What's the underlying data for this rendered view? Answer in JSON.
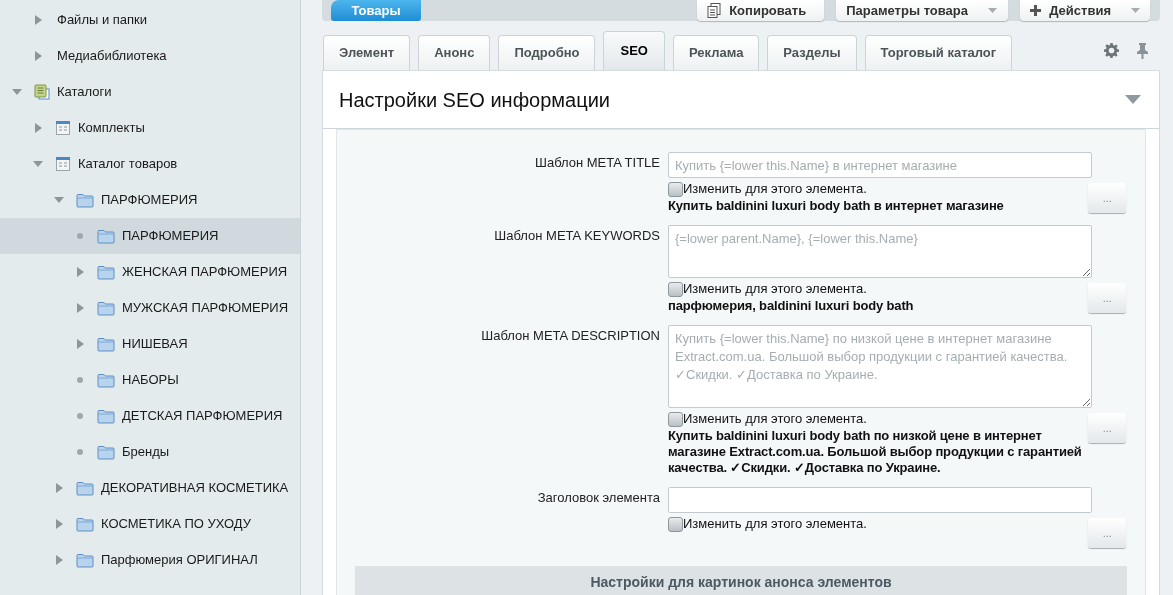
{
  "sidebar": {
    "items": [
      {
        "label": "Файлы и папки",
        "kind": "plain",
        "expanded": false,
        "selected": false
      },
      {
        "label": "Медиабиблиотека",
        "kind": "plain",
        "expanded": false,
        "selected": false
      },
      {
        "label": "Каталоги",
        "kind": "catalog",
        "expanded": true,
        "selected": false,
        "children": [
          {
            "label": "Комплекты",
            "kind": "list",
            "expanded": false,
            "selected": false
          },
          {
            "label": "Каталог товаров",
            "kind": "list",
            "expanded": true,
            "selected": false,
            "children": [
              {
                "label": "ПАРФЮМЕРИЯ",
                "kind": "folder",
                "expanded": true,
                "selected": false,
                "children": [
                  {
                    "label": "ПАРФЮМЕРИЯ",
                    "kind": "folder",
                    "selected": true
                  },
                  {
                    "label": "ЖЕНСКАЯ ПАРФЮМЕРИЯ",
                    "kind": "folder",
                    "expanded": false,
                    "selected": false
                  },
                  {
                    "label": "МУЖСКАЯ ПАРФЮМЕРИЯ",
                    "kind": "folder",
                    "expanded": false,
                    "selected": false
                  },
                  {
                    "label": "НИШЕВАЯ",
                    "kind": "folder",
                    "expanded": false,
                    "selected": false
                  },
                  {
                    "label": "НАБОРЫ",
                    "kind": "folder",
                    "selected": false
                  },
                  {
                    "label": "ДЕТСКАЯ ПАРФЮМЕРИЯ",
                    "kind": "folder",
                    "selected": false
                  },
                  {
                    "label": "Бренды",
                    "kind": "folder",
                    "selected": false
                  }
                ]
              },
              {
                "label": "ДЕКОРАТИВНАЯ КОСМЕТИКА",
                "kind": "folder",
                "expanded": false,
                "selected": false
              },
              {
                "label": "КОСМЕТИКА ПО УХОДУ",
                "kind": "folder",
                "expanded": false,
                "selected": false
              },
              {
                "label": "Парфюмерия ОРИГИНАЛ",
                "kind": "folder",
                "expanded": false,
                "selected": false
              }
            ]
          }
        ]
      }
    ]
  },
  "toolbar": {
    "back_button": "Товары",
    "buttons": [
      {
        "label": "Копировать",
        "kind": "copy",
        "dropdown": false
      },
      {
        "label": "Параметры товара",
        "kind": "plain",
        "dropdown": true
      },
      {
        "label": "Действия",
        "kind": "add",
        "dropdown": true
      }
    ]
  },
  "tabs": [
    {
      "label": "Элемент",
      "selected": false
    },
    {
      "label": "Анонс",
      "selected": false
    },
    {
      "label": "Подробно",
      "selected": false
    },
    {
      "label": "SEO",
      "selected": true
    },
    {
      "label": "Реклама",
      "selected": false
    },
    {
      "label": "Разделы",
      "selected": false
    },
    {
      "label": "Торговый каталог",
      "selected": false
    }
  ],
  "panel": {
    "title": "Настройки SEO информации",
    "fields": [
      {
        "label": "Шаблон META TITLE",
        "kind": "input",
        "placeholder": "Купить {=lower this.Name} в интернет магазине",
        "checkbox_label": "Изменить для этого элемента.",
        "checked": false,
        "computed": "Купить baldinini luxuri body bath в интернет магазине",
        "button": "..."
      },
      {
        "label": "Шаблон META KEYWORDS",
        "kind": "textarea",
        "placeholder": "{=lower parent.Name}, {=lower this.Name}",
        "checkbox_label": "Изменить для этого элемента.",
        "checked": false,
        "computed": "парфюмерия, baldinini luxuri body bath",
        "button": "..."
      },
      {
        "label": "Шаблон META DESCRIPTION",
        "kind": "tall_textarea",
        "placeholder": "Купить {=lower this.Name} по низкой цене в интернет магазине Extract.com.ua. Большой выбор продукции с гарантией качества. ✓Скидки. ✓Доставка по Украине.",
        "checkbox_label": "Изменить для этого элемента.",
        "checked": false,
        "computed": "Купить baldinini luxuri body bath по низкой цене в интернет магазине Extract.com.ua. Большой выбор продукции с гарантией качества. ✓Скидки. ✓Доставка по Украине.",
        "button": "..."
      },
      {
        "label": "Заголовок элемента",
        "kind": "input",
        "checkbox_label": "Изменить для этого элемента.",
        "checked": false,
        "button": "..."
      }
    ],
    "section_header": "Настройки для картинок анонса элементов"
  }
}
